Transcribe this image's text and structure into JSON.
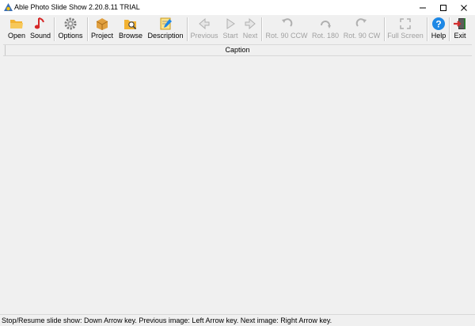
{
  "window": {
    "title": "Able Photo Slide Show 2.20.8.11 TRIAL"
  },
  "toolbar": {
    "open": "Open",
    "sound": "Sound",
    "options": "Options",
    "project": "Project",
    "browse": "Browse",
    "description": "Description",
    "previous": "Previous",
    "start": "Start",
    "next": "Next",
    "rot_ccw": "Rot. 90 CCW",
    "rot_180": "Rot. 180",
    "rot_cw": "Rot. 90 CW",
    "full_screen": "Full Screen",
    "help": "Help",
    "exit": "Exit"
  },
  "caption": {
    "label": "Caption"
  },
  "status": {
    "text": "Stop/Resume slide show: Down Arrow key. Previous image: Left Arrow key. Next image: Right Arrow key."
  },
  "colors": {
    "accent_blue": "#1e88e5",
    "exit_red": "#d32f2f",
    "disabled_text": "#a0a0a0"
  },
  "icons": [
    "folder-open-icon",
    "music-note-icon",
    "gear-icon",
    "package-icon",
    "browse-folder-icon",
    "notepad-pencil-icon",
    "arrow-left-icon",
    "play-icon",
    "arrow-right-icon",
    "rotate-ccw-icon",
    "rotate-180-icon",
    "rotate-cw-icon",
    "fullscreen-icon",
    "help-icon",
    "exit-door-icon"
  ]
}
